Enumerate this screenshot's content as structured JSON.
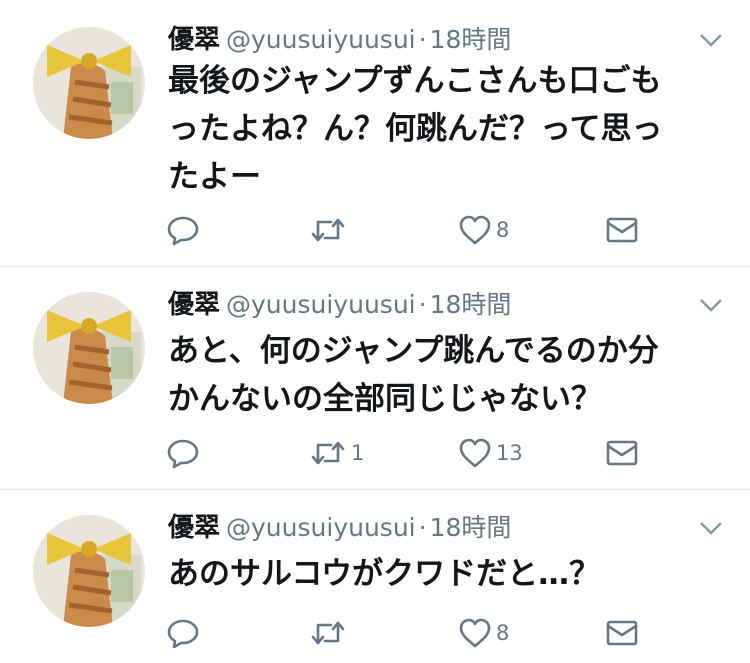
{
  "tweets": [
    {
      "display_name": "優翠",
      "handle": "@yuusuiyuusui",
      "separator": "·",
      "time": "18時間",
      "text": "最後のジャンプずんこさんも口ごも\nったよね？ん？何跳んだ？って思っ\nたよー",
      "reply_count": "",
      "retweet_count": "",
      "like_count": "8"
    },
    {
      "display_name": "優翠",
      "handle": "@yuusuiyuusui",
      "separator": "·",
      "time": "18時間",
      "text": "あと、何のジャンプ跳んでるのか分\nかんないの全部同じじゃない？",
      "reply_count": "",
      "retweet_count": "1",
      "like_count": "13"
    },
    {
      "display_name": "優翠",
      "handle": "@yuusuiyuusui",
      "separator": "·",
      "time": "18時間",
      "text": "あのサルコウがクワドだと…？",
      "reply_count": "",
      "retweet_count": "",
      "like_count": "8"
    }
  ],
  "icons": {
    "reply": "reply-icon",
    "retweet": "retweet-icon",
    "like": "heart-icon",
    "dm": "envelope-icon",
    "menu": "chevron-down-icon"
  },
  "colors": {
    "text": "#14171a",
    "muted": "#657786",
    "divider": "#e1e8ed"
  }
}
